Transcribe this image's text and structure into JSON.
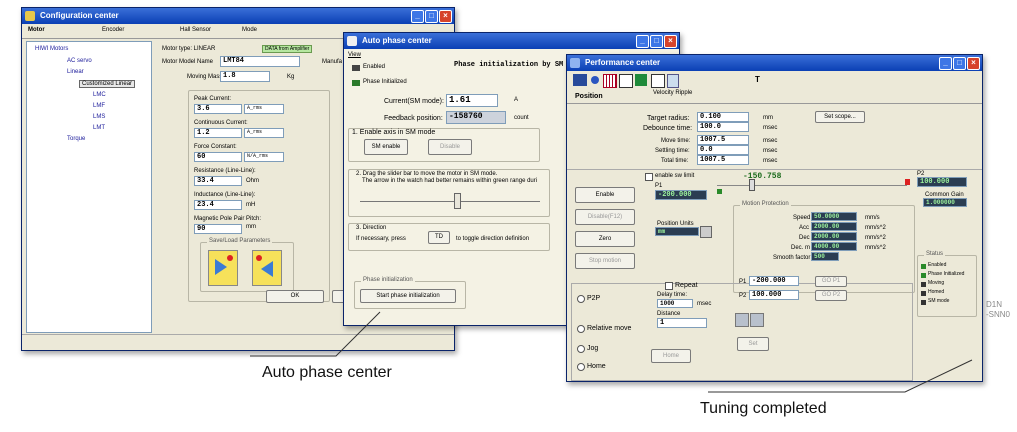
{
  "config_window": {
    "title": "Configuration center",
    "tabs": [
      "Motor",
      "Encoder",
      "Hall Sensor",
      "Mode"
    ],
    "tree": {
      "root": "HIWI Motors",
      "items": [
        "AC servo",
        "Linear",
        "Customized Linear",
        "LMC",
        "LMF",
        "LMS",
        "LMT",
        "Torque"
      ]
    },
    "motor_type": "Motor type: LINEAR",
    "amplifier_badge": "DATA from Amplifier",
    "model_name_label": "Motor Model Name",
    "model_name_value": "LMT84",
    "manufacturer_label": "Manufa",
    "moving_mass_label": "Moving Mass:",
    "moving_mass_value": "1.8",
    "moving_mass_unit": "Kg",
    "peak_current_label": "Peak Current:",
    "peak_current_value": "3.6",
    "peak_current_unit": "A_rms",
    "cont_current_label": "Continuous Current:",
    "cont_current_value": "1.2",
    "cont_current_unit": "A_rms",
    "force_const_label": "Force Constant:",
    "force_const_value": "60",
    "force_const_unit": "N/A_rms",
    "resistance_label": "Resistance (Line-Line):",
    "resistance_value": "33.4",
    "resistance_unit": "Ohm",
    "inductance_label": "Inductance (Line-Line):",
    "inductance_value": "23.4",
    "inductance_unit": "mH",
    "pole_pitch_label": "Magnetic Pole Pair Pitch:",
    "pole_pitch_value": "90",
    "pole_pitch_unit": "mm",
    "save_load_label": "Save/Load Parameters",
    "ok_label": "OK",
    "other_btn_label": "C"
  },
  "phase_window": {
    "title": "Auto phase center",
    "menu_view": "View",
    "enabled_label": "Enabled",
    "phase_init_label": "Phase Initialized",
    "heading": "Phase initialization by SM",
    "current_label": "Current(SM mode):",
    "current_value": "1.61",
    "current_unit": "A",
    "feedback_label": "Feedback position:",
    "feedback_value": "-158760",
    "feedback_unit": "count",
    "step1_label": "1. Enable axis in SM mode",
    "sm_enable_label": "SM enable",
    "disable_label": "Disable",
    "step2_label": "2. Drag the slider bar to move the motor in SM mode.",
    "step2_sub": "The arrow in the watch had better remains within green range duri",
    "step3_label": "3. Direction",
    "step3_text": "If necessary, press",
    "td_label": "TD",
    "step3_suffix": "to toggle direction definition",
    "phase_init_group": "Phase initialization",
    "start_label": "Start phase initialization"
  },
  "perf_window": {
    "title": "Performance center",
    "toolbar_T": "T",
    "tabs": [
      "Position",
      "Velocity Ripple"
    ],
    "target_radius_label": "Target radius:",
    "target_radius_value": "0.100",
    "target_radius_unit": "mm",
    "debounce_label": "Debounce time:",
    "debounce_value": "100.0",
    "debounce_unit": "msec",
    "move_time_label": "Move time:",
    "move_time_value": "1007.5",
    "move_time_unit": "msec",
    "settling_label": "Settling time:",
    "settling_value": "0.0",
    "settling_unit": "msec",
    "total_time_label": "Total time:",
    "total_time_value": "1007.5",
    "total_time_unit": "msec",
    "set_scope_label": "Set scope...",
    "enable_sw_limit": "enable sw limit",
    "position_readout": "-150.758",
    "p1_label": "P1",
    "p1_value": "-200.000",
    "p2_label": "P2",
    "p2_value": "100.000",
    "comm_gain_label": "Common Gain",
    "comm_gain_value": "1.000000",
    "enable_btn": "Enable",
    "disable_btn": "Disable(F12)",
    "zero_btn": "Zero",
    "stop_btn": "Stop motion",
    "pos_units_label": "Position Units",
    "pos_units_value": "mm",
    "motion_prot_label": "Motion Protection",
    "speed_label": "Speed",
    "speed_value": "50.0000",
    "speed_unit": "mm/s",
    "acc_label": "Acc",
    "acc_value": "2000.00",
    "acc_unit": "mm/s^2",
    "dec_label": "Dec",
    "dec_value": "2000.00",
    "dec_unit": "mm/s^2",
    "decm_label": "Dec. m",
    "decm_value": "4000.00",
    "decm_unit": "mm/s^2",
    "smooth_label": "Smooth factor",
    "smooth_value": "500",
    "status_label": "Status",
    "status_items": [
      "Enabled",
      "Phase Initialized",
      "Moving",
      "Homed",
      "SM mode"
    ],
    "p2p_label": "P2P",
    "repeat_label": "Repeat",
    "delay_label": "Delay time:",
    "delay_value": "1000",
    "delay_unit": "msec",
    "p1_row_label": "P1",
    "p1_row_value": "-200.000",
    "p2_row_label": "P2",
    "p2_row_value": "100.000",
    "go_label": "GO P1",
    "go2_label": "GO P2",
    "relative_label": "Relative move",
    "distance_label": "Distance",
    "distance_value": "1",
    "jog_label": "Jog",
    "home_label": "Home",
    "home_btn": "Home",
    "set_btn": "Set"
  },
  "captions": {
    "auto_phase": "Auto phase center",
    "tuning": "Tuning completed",
    "side_code_1": "D1N",
    "side_code_2": "-SNN0"
  }
}
